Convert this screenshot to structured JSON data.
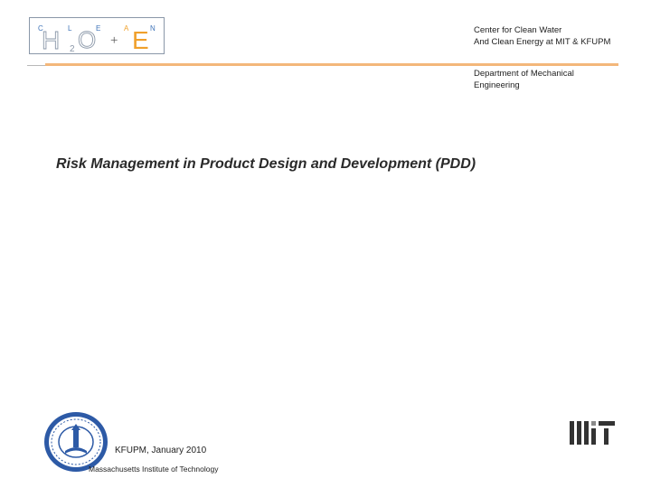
{
  "header": {
    "logo": {
      "letters_top": [
        "C",
        "L",
        "E",
        "A",
        "N"
      ],
      "h": "H",
      "subscript": "2",
      "o": "O",
      "plus": "+",
      "e": "E",
      "colors": {
        "blue": "#3f73b8",
        "orange": "#f0a02b",
        "gray": "#8a97a8"
      }
    },
    "center_name_line1": "Center for Clean Water",
    "center_name_line2": "And Clean Energy at MIT & KFUPM",
    "department_line1": "Department of Mechanical",
    "department_line2": "Engineering",
    "accent_color": "#f3b77a"
  },
  "main": {
    "title": "Risk Management in Product Design and Development (PDD)"
  },
  "footer": {
    "event": "KFUPM, January 2010",
    "institution": "Massachusetts Institute of Technology",
    "seal_icon": "kfupm-seal-icon",
    "mit_logo_icon": "mit-logo-icon"
  }
}
